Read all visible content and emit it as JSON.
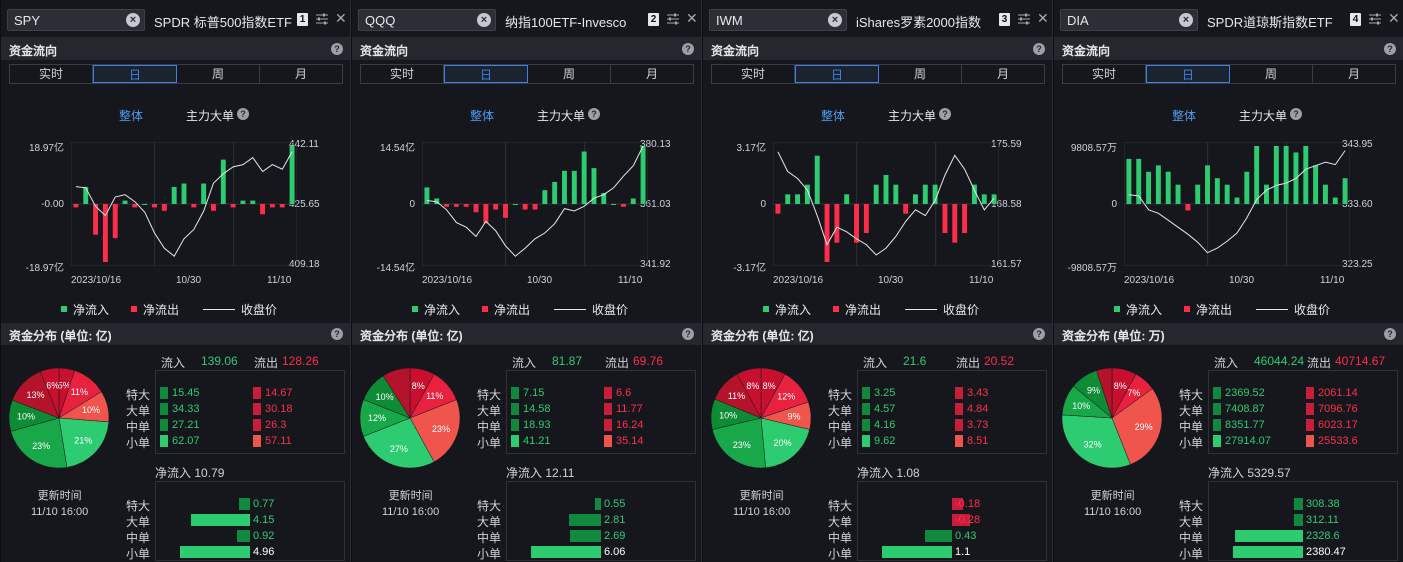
{
  "colors": {
    "inflow": "#2ecc71",
    "outflow": "#ff2d4a",
    "accent": "#3c82e6",
    "dk_green": "#10893e",
    "dk_red": "#c81e3c",
    "pie": [
      "#c8102e",
      "#e8213f",
      "#f0554d",
      "#2ecc71",
      "#18a84a",
      "#0f8a35"
    ]
  },
  "labels": {
    "tabs": [
      "实时",
      "日",
      "周",
      "月"
    ],
    "active_tab": 1,
    "section_flow": "资金流向",
    "sub_all": "整体",
    "sub_main": "主力大单",
    "legend_in": "净流入",
    "legend_out": "净流出",
    "legend_close": "收盘价",
    "inflow": "流入",
    "outflow": "流出",
    "rows": [
      "特大",
      "大单",
      "中单",
      "小单"
    ],
    "net_prefix": "净流入",
    "updated": "更新时间",
    "updated_time": "11/10 16:00",
    "x_start": "2023/10/16",
    "x_mid": "10/30",
    "x_end": "11/10",
    "help": "?",
    "clear": "×",
    "close": "✕"
  },
  "panels": [
    {
      "ticker": "SPY",
      "name": "SPDR 标普500指数ETF",
      "num": "1",
      "dist_title": "资金分布 (单位: 亿)",
      "y_left": [
        "18.97亿",
        "-0.00",
        "-18.97亿"
      ],
      "y_right": [
        "442.11",
        "425.65",
        "409.18"
      ],
      "flows": [
        -1,
        5,
        -9,
        -17,
        -10,
        1,
        -1,
        0,
        -1,
        -2,
        5,
        6,
        -1,
        6,
        -2,
        13,
        -1,
        1,
        1,
        -3,
        -1,
        -1,
        17
      ],
      "close": [
        0.65,
        0.64,
        0.48,
        0.4,
        0.56,
        0.58,
        0.52,
        0.43,
        0.25,
        0.12,
        0.05,
        0.2,
        0.28,
        0.44,
        0.68,
        0.76,
        0.82,
        0.84,
        0.9,
        0.78,
        0.84,
        0.8,
        0.95
      ],
      "inflow": "139.06",
      "outflow": "128.26",
      "in_vals": [
        "15.45",
        "34.33",
        "27.21",
        "62.07"
      ],
      "out_vals": [
        "14.67",
        "30.18",
        "26.3",
        "57.11"
      ],
      "pie_vals": [
        5,
        11,
        10,
        21,
        23,
        10,
        13,
        6
      ],
      "pie_labels": [
        "5%",
        "11%",
        "10%",
        "21%",
        "23%",
        "10%",
        "13%",
        "6%"
      ],
      "net": "10.79",
      "net_vals": [
        "0.77",
        "4.15",
        "0.92",
        "4.96"
      ],
      "net_dir": [
        1,
        1,
        1,
        1
      ]
    },
    {
      "ticker": "QQQ",
      "name": "纳指100ETF-Invesco",
      "num": "2",
      "dist_title": "资金分布 (单位: 亿)",
      "y_left": [
        "14.54亿",
        "0",
        "-14.54亿"
      ],
      "y_right": [
        "380.13",
        "361.03",
        "341.92"
      ],
      "flows": [
        6,
        2,
        -1,
        -1,
        -1,
        -3,
        -7,
        -2,
        -5,
        0,
        -2,
        -2,
        5,
        8,
        12,
        12,
        19,
        13,
        4,
        0,
        -1,
        2,
        21
      ],
      "close": [
        0.53,
        0.52,
        0.45,
        0.34,
        0.3,
        0.22,
        0.35,
        0.27,
        0.14,
        0.05,
        0.12,
        0.2,
        0.25,
        0.33,
        0.46,
        0.44,
        0.48,
        0.55,
        0.58,
        0.64,
        0.74,
        0.83,
        1.0
      ],
      "inflow": "81.87",
      "outflow": "69.76",
      "in_vals": [
        "7.15",
        "14.58",
        "18.93",
        "41.21"
      ],
      "out_vals": [
        "6.6",
        "11.77",
        "16.24",
        "35.14"
      ],
      "pie_vals": [
        8,
        11,
        23,
        27,
        12,
        10,
        9
      ],
      "pie_labels": [
        "8%",
        "11%",
        "23%",
        "27%",
        "12%",
        "10%",
        ""
      ],
      "net": "12.11",
      "net_vals": [
        "0.55",
        "2.81",
        "2.69",
        "6.06"
      ],
      "net_dir": [
        1,
        1,
        1,
        1
      ]
    },
    {
      "ticker": "IWM",
      "name": "iShares罗素2000指数",
      "num": "3",
      "dist_title": "资金分布 (单位: 亿)",
      "y_left": [
        "3.17亿",
        "0",
        "-3.17亿"
      ],
      "y_right": [
        "175.59",
        "168.58",
        "161.57"
      ],
      "flows": [
        -1,
        1,
        1,
        2,
        5,
        -6,
        -4,
        1,
        -4,
        -3,
        2,
        3,
        2,
        -1,
        1,
        2,
        2,
        -3,
        -4,
        -3,
        2,
        1,
        1
      ],
      "close": [
        0.95,
        0.78,
        0.72,
        0.62,
        0.4,
        0.15,
        0.3,
        0.26,
        0.2,
        0.15,
        0.06,
        0.12,
        0.22,
        0.35,
        0.45,
        0.4,
        0.53,
        0.75,
        0.92,
        0.8,
        0.62,
        0.45,
        0.55
      ],
      "inflow": "21.6",
      "outflow": "20.52",
      "in_vals": [
        "3.25",
        "4.57",
        "4.16",
        "9.62"
      ],
      "out_vals": [
        "3.43",
        "4.84",
        "3.73",
        "8.51"
      ],
      "pie_vals": [
        8,
        12,
        9,
        20,
        23,
        10,
        11,
        8
      ],
      "pie_labels": [
        "8%",
        "12%",
        "9%",
        "20%",
        "23%",
        "10%",
        "11%",
        "8%"
      ],
      "net": "1.08",
      "net_vals": [
        "-0.18",
        "-0.28",
        "0.43",
        "1.1"
      ],
      "net_dir": [
        -1,
        -1,
        1,
        1
      ]
    },
    {
      "ticker": "DIA",
      "name": "SPDR道琼斯指数ETF",
      "num": "4",
      "dist_title": "资金分布 (单位: 万)",
      "y_left": [
        "9808.57万",
        "0",
        "-9808.57万"
      ],
      "y_right": [
        "343.95",
        "333.60",
        "323.25"
      ],
      "flows": [
        7,
        7,
        5,
        6,
        5,
        3,
        -1,
        3,
        6,
        4,
        3,
        1,
        5,
        9,
        3,
        9,
        9,
        8,
        9,
        6,
        3,
        1,
        4
      ],
      "close": [
        0.58,
        0.57,
        0.45,
        0.42,
        0.36,
        0.3,
        0.24,
        0.17,
        0.08,
        0.12,
        0.18,
        0.25,
        0.38,
        0.54,
        0.62,
        0.66,
        0.68,
        0.72,
        0.8,
        0.83,
        0.86,
        0.84,
        0.96
      ],
      "inflow": "46044.24",
      "outflow": "40714.67",
      "in_vals": [
        "2369.52",
        "7408.87",
        "8351.77",
        "27914.07"
      ],
      "out_vals": [
        "2061.14",
        "7096.76",
        "6023.17",
        "25533.6"
      ],
      "pie_vals": [
        8,
        7,
        29,
        32,
        10,
        9,
        5
      ],
      "pie_labels": [
        "8%",
        "7%",
        "29%",
        "32%",
        "10%",
        "9%",
        ""
      ],
      "net": "5329.57",
      "net_vals": [
        "308.38",
        "312.11",
        "2328.6",
        "2380.47"
      ],
      "net_dir": [
        1,
        1,
        1,
        1
      ]
    }
  ]
}
